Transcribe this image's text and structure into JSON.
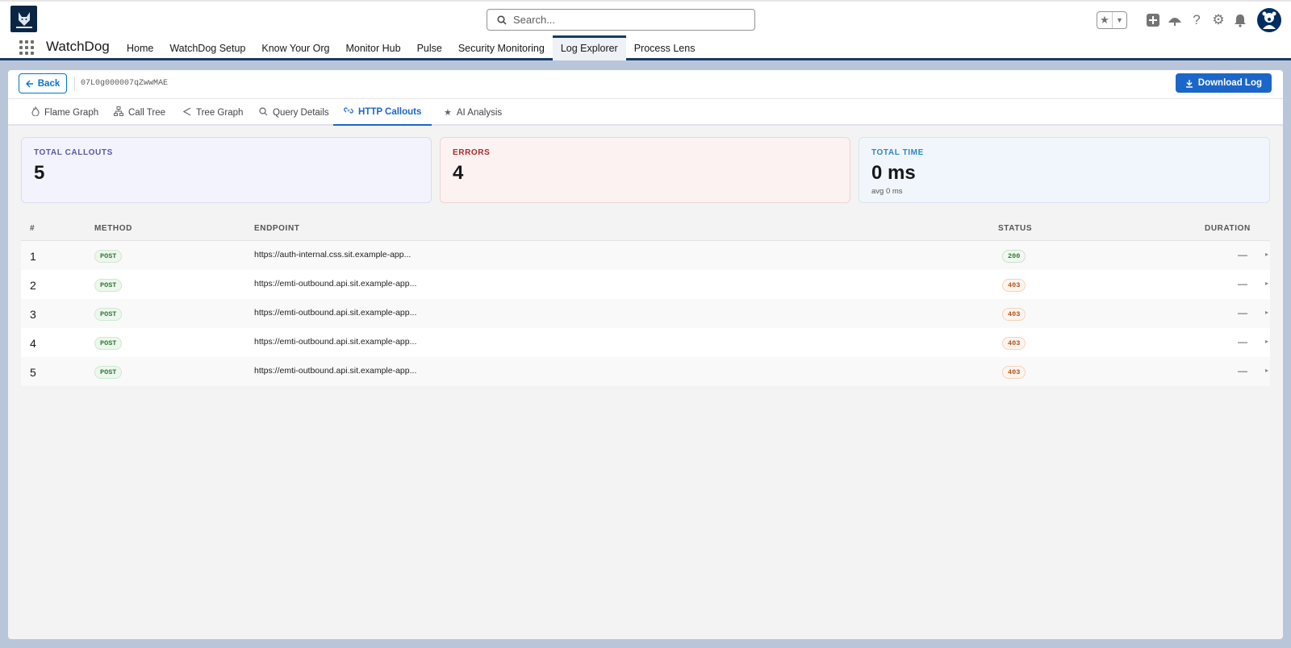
{
  "header": {
    "logo_label": "WATCHDOG",
    "search_placeholder": "Search..."
  },
  "app": {
    "name": "WatchDog",
    "nav": [
      {
        "label": "Home"
      },
      {
        "label": "WatchDog Setup"
      },
      {
        "label": "Know Your Org"
      },
      {
        "label": "Monitor Hub"
      },
      {
        "label": "Pulse"
      },
      {
        "label": "Security Monitoring"
      },
      {
        "label": "Log Explorer",
        "active": true
      },
      {
        "label": "Process Lens"
      }
    ]
  },
  "toolbar": {
    "back_label": "Back",
    "log_id": "07L0g000007qZwwMAE",
    "download_label": "Download Log"
  },
  "tabs": [
    {
      "label": "Flame Graph",
      "icon": "flame-icon"
    },
    {
      "label": "Call Tree",
      "icon": "hierarchy-icon"
    },
    {
      "label": "Tree Graph",
      "icon": "share-icon"
    },
    {
      "label": "Query Details",
      "icon": "search-icon"
    },
    {
      "label": "HTTP Callouts",
      "icon": "link-icon",
      "active": true
    },
    {
      "label": "AI Analysis",
      "icon": "star-icon"
    }
  ],
  "summary": {
    "total_callouts": {
      "label": "TOTAL CALLOUTS",
      "value": "5"
    },
    "errors": {
      "label": "ERRORS",
      "value": "4"
    },
    "total_time": {
      "label": "TOTAL TIME",
      "value": "0 ms",
      "sub": "avg 0 ms"
    }
  },
  "table": {
    "columns": {
      "num": "#",
      "method": "METHOD",
      "endpoint": "ENDPOINT",
      "status": "STATUS",
      "duration": "DURATION"
    },
    "rows": [
      {
        "num": "1",
        "method": "POST",
        "endpoint": "https://auth-internal.css.sit.example-app...",
        "status": "200",
        "duration": "—"
      },
      {
        "num": "2",
        "method": "POST",
        "endpoint": "https://emti-outbound.api.sit.example-app...",
        "status": "403",
        "duration": "—"
      },
      {
        "num": "3",
        "method": "POST",
        "endpoint": "https://emti-outbound.api.sit.example-app...",
        "status": "403",
        "duration": "—"
      },
      {
        "num": "4",
        "method": "POST",
        "endpoint": "https://emti-outbound.api.sit.example-app...",
        "status": "403",
        "duration": "—"
      },
      {
        "num": "5",
        "method": "POST",
        "endpoint": "https://emti-outbound.api.sit.example-app...",
        "status": "403",
        "duration": "—"
      }
    ]
  },
  "colors": {
    "brand_blue": "#1b66c9",
    "nav_accent": "#1b3a63",
    "error_red": "#a82a2a",
    "success_green": "#2e7d32"
  }
}
